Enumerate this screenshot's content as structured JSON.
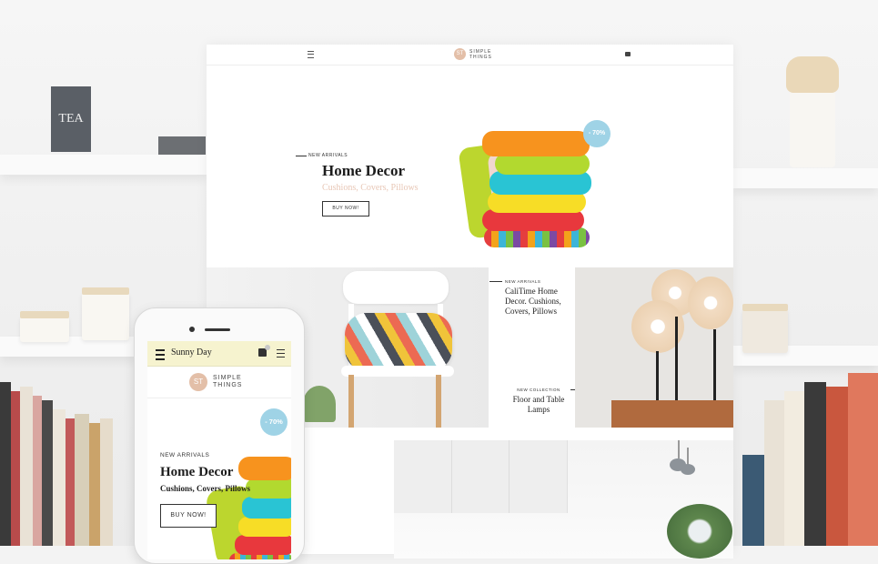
{
  "background": {
    "tea_label": "TEA"
  },
  "desktop": {
    "brand_initials": "ST",
    "brand_line1": "SIMPLE",
    "brand_line2": "THINGS",
    "hero": {
      "kicker": "NEW ARRIVALS",
      "title": "Home Decor",
      "subtitle": "Cushions, Covers, Pillows",
      "button": "BUY NOW!",
      "badge": "- 70%",
      "active_slide": 2
    },
    "promo1": {
      "kicker": "NEW ARRIVALS",
      "title": "CaliTime Home Decor. Cushions, Covers, Pillows"
    },
    "promo2": {
      "kicker": "NEW COLLECTION",
      "title": "Floor and Table Lamps"
    }
  },
  "mobile": {
    "shop_name": "Sunny Day",
    "brand_initials": "ST",
    "brand_line1": "SIMPLE",
    "brand_line2": "THINGS",
    "hero": {
      "kicker": "NEW ARRIVALS",
      "title": "Home Decor",
      "subtitle": "Cushions, Covers, Pillows",
      "button": "BUY NOW!",
      "badge": "- 70%"
    }
  },
  "colors": {
    "accent": "#e3bfa8",
    "badge": "#9fd3e6",
    "mobile_bar": "#f6f3cf"
  }
}
